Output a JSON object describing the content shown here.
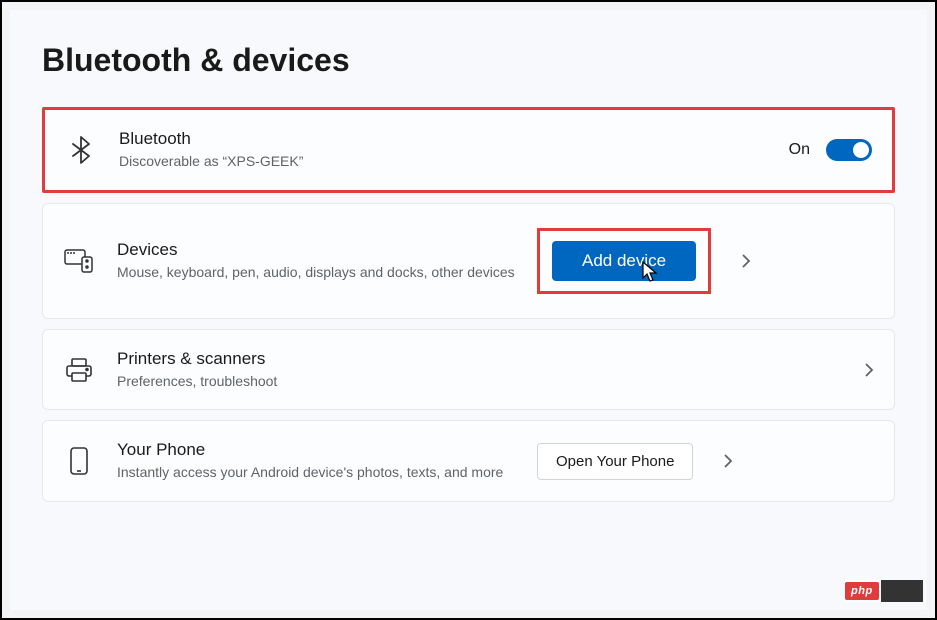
{
  "page_title": "Bluetooth & devices",
  "bluetooth": {
    "title": "Bluetooth",
    "subtitle": "Discoverable as “XPS-GEEK”",
    "state_label": "On",
    "state": true
  },
  "devices": {
    "title": "Devices",
    "subtitle": "Mouse, keyboard, pen, audio, displays and docks, other devices",
    "button_label": "Add device"
  },
  "printers": {
    "title": "Printers & scanners",
    "subtitle": "Preferences, troubleshoot"
  },
  "phone": {
    "title": "Your Phone",
    "subtitle": "Instantly access your Android device's photos, texts, and more",
    "button_label": "Open Your Phone"
  },
  "watermark": "php"
}
